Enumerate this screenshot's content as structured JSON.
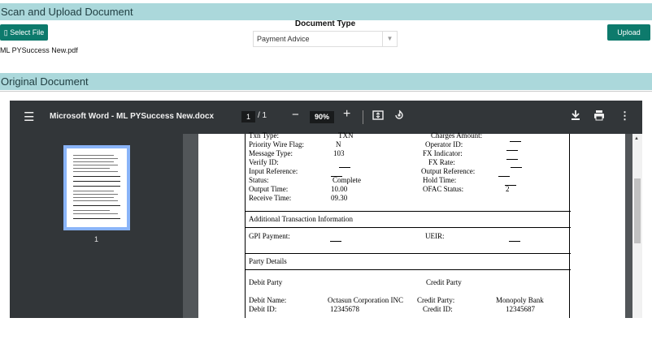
{
  "scan": {
    "section_title": "Scan and Upload Document",
    "select_file_label": "▯ Select File",
    "doc_type_label": "Document Type",
    "doc_type_value": "Payment Advice",
    "upload_label": "Upload",
    "filename": "ML PYSuccess New.pdf"
  },
  "original": {
    "section_title": "Original Document"
  },
  "viewer": {
    "title": "Microsoft Word - ML PYSuccess New.docx",
    "page_current": "1",
    "page_sep": "/ 1",
    "zoom": "90%",
    "thumb_number": "1"
  },
  "doc": {
    "left_rows": [
      {
        "label": "Txn Type:",
        "value": "TXN"
      },
      {
        "label": "Priority Wire Flag:",
        "value": "N"
      },
      {
        "label": "Message Type:",
        "value": "103"
      },
      {
        "label": "Verify ID:",
        "value": ""
      },
      {
        "label": "Input Reference:",
        "value": ""
      },
      {
        "label": "Status:",
        "value": "Complete"
      },
      {
        "label": "Output Time:",
        "value": "10.00"
      },
      {
        "label": "Receive Time:",
        "value": "09.30"
      }
    ],
    "right_rows": [
      {
        "label": "Charges Amount:",
        "value": ""
      },
      {
        "label": "Operator ID:",
        "value": ""
      },
      {
        "label": "FX Indicator:",
        "value": ""
      },
      {
        "label": "FX Rate:",
        "value": ""
      },
      {
        "label": "Output Reference:",
        "value": ""
      },
      {
        "label": "Hold Time:",
        "value": ""
      },
      {
        "label": "OFAC Status:",
        "value": "2"
      }
    ],
    "section_additional": "Additional Transaction Information",
    "gpi_label": "GPI Payment:",
    "ueir_label": "UEIR:",
    "section_party": "Party Details",
    "debit_party": "Debit Party",
    "credit_party": "Credit Party",
    "debit_name_label": "Debit Name:",
    "debit_name_value": "Octasun Corporation INC",
    "debit_id_label": "Debit ID:",
    "debit_id_value": "12345678",
    "credit_party_label": "Credit Party:",
    "credit_party_value": "Monopoly Bank",
    "credit_id_label": "Credit ID:",
    "credit_id_value": "12345687"
  }
}
